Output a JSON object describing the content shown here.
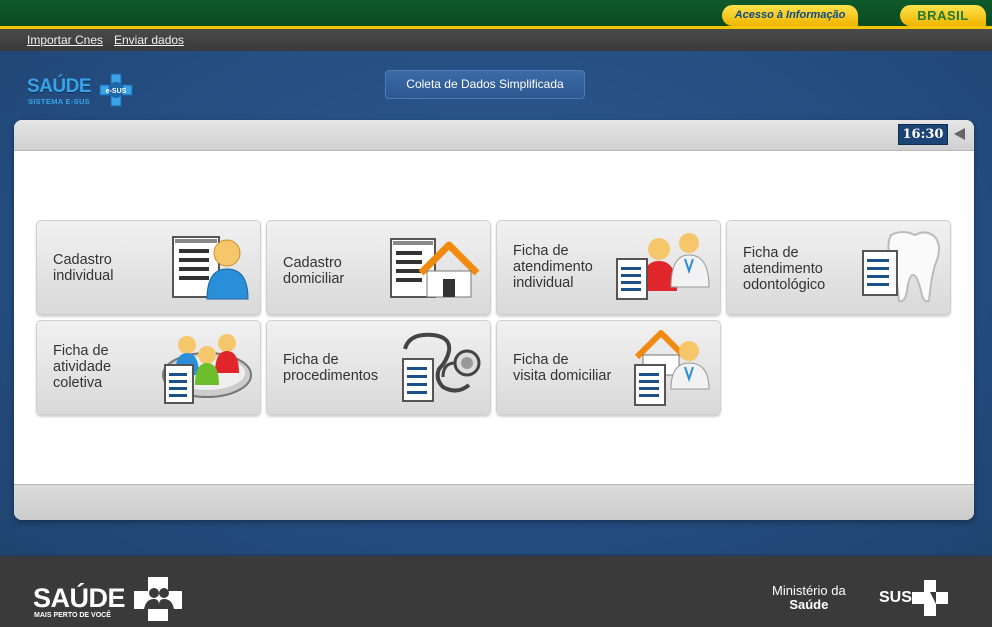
{
  "gov_bar": {
    "acesso_label": "Acesso à Informação",
    "brasil_label": "BRASIL"
  },
  "links": [
    {
      "label": "Importar Cnes"
    },
    {
      "label": "Enviar dados"
    }
  ],
  "header": {
    "logo_text": "SAÚDE",
    "logo_badge": "e-SUS",
    "logo_subtitle": "SISTEMA E-SUS",
    "app_title": "Coleta de Dados Simplificada"
  },
  "toolbar": {
    "clock": "16:30"
  },
  "tiles": [
    {
      "lines": [
        "Cadastro",
        "individual"
      ],
      "icon": "cadastro-individual-icon"
    },
    {
      "lines": [
        "Cadastro",
        "domiciliar"
      ],
      "icon": "cadastro-domiciliar-icon"
    },
    {
      "lines": [
        "Ficha de",
        "atendimento",
        "individual"
      ],
      "icon": "atendimento-individual-icon"
    },
    {
      "lines": [
        "Ficha de",
        "atendimento",
        "odontológico"
      ],
      "icon": "atendimento-odontologico-icon"
    },
    {
      "lines": [
        "Ficha de",
        "atividade",
        "coletiva"
      ],
      "icon": "atividade-coletiva-icon"
    },
    {
      "lines": [
        "Ficha de",
        "procedimentos"
      ],
      "icon": "procedimentos-icon"
    },
    {
      "lines": [
        "Ficha de",
        "visita domiciliar"
      ],
      "icon": "visita-domiciliar-icon"
    }
  ],
  "footer": {
    "saude_logo": "SAÚDE",
    "saude_tagline": "MAIS PERTO DE VOCÊ",
    "ministerio_line1": "Ministério da",
    "ministerio_line2": "Saúde",
    "sus_label": "SUS"
  },
  "colors": {
    "gov_green": "#0f5a2a",
    "gov_yellow": "#f5c400",
    "main_blue": "#2a5286",
    "clock_bg": "#1c4576",
    "footer_gray": "#3a3a3a"
  }
}
